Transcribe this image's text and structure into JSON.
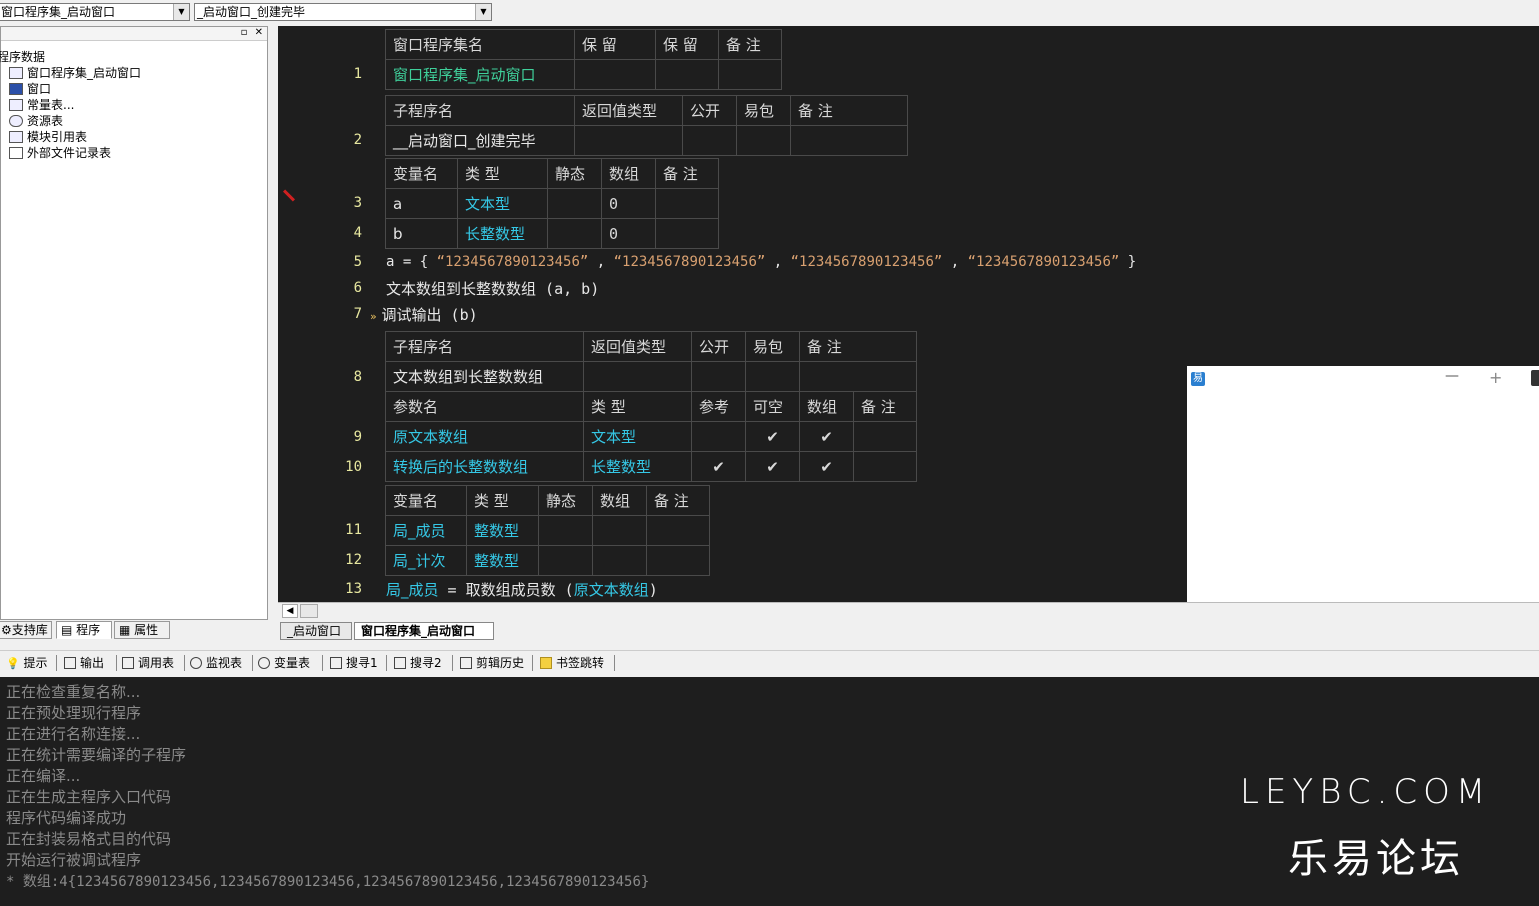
{
  "top": {
    "combo1": "窗口程序集_启动窗口",
    "combo2": "_启动窗口_创建完毕"
  },
  "tree": {
    "root": "程序数据",
    "items": [
      "窗口程序集_启动窗口",
      "窗口",
      "常量表...",
      "资源表",
      "模块引用表",
      "外部文件记录表"
    ]
  },
  "left_tabs": [
    "支持库",
    "程序",
    "属性"
  ],
  "editor": {
    "line_numbers": [
      "1",
      "2",
      "3",
      "4",
      "5",
      "6",
      "7",
      "8",
      "9",
      "10",
      "11",
      "12",
      "13"
    ],
    "t1": {
      "headers": [
        "窗口程序集名",
        "保 留",
        "保 留",
        "备 注"
      ],
      "row": [
        "窗口程序集_启动窗口",
        "",
        "",
        ""
      ]
    },
    "t2": {
      "headers": [
        "子程序名",
        "返回值类型",
        "公开",
        "易包",
        "备 注"
      ],
      "row": [
        "__启动窗口_创建完毕",
        "",
        "",
        "",
        ""
      ]
    },
    "t3": {
      "headers": [
        "变量名",
        "类 型",
        "静态",
        "数组",
        "备 注"
      ],
      "rows": [
        [
          "a",
          "文本型",
          "",
          "0",
          ""
        ],
        [
          "b",
          "长整数型",
          "",
          "0",
          ""
        ]
      ]
    },
    "line5": {
      "lhs": "a = { ",
      "s1": "“1234567890123456”",
      "comma": " , ",
      "s2": "“1234567890123456”",
      "s3": "“1234567890123456”",
      "s4": "“1234567890123456”",
      "close": "  }"
    },
    "line6": {
      "fn": "文本数组到长整数数组",
      "args": " (a, b)"
    },
    "line7": {
      "marker": "»",
      "fn": "调试输出",
      "args": " (b)"
    },
    "t4": {
      "headers": [
        "子程序名",
        "返回值类型",
        "公开",
        "易包",
        "备 注"
      ],
      "row": [
        "文本数组到长整数数组",
        "",
        "",
        "",
        ""
      ],
      "pheaders": [
        "参数名",
        "类 型",
        "参考",
        "可空",
        "数组",
        "备 注"
      ],
      "prows": [
        [
          "原文本数组",
          "文本型",
          "",
          "✔",
          "✔",
          ""
        ],
        [
          "转换后的长整数数组",
          "长整数型",
          "✔",
          "✔",
          "✔",
          ""
        ]
      ]
    },
    "t5": {
      "headers": [
        "变量名",
        "类 型",
        "静态",
        "数组",
        "备 注"
      ],
      "rows": [
        [
          "局_成员",
          "整数型",
          "",
          "",
          ""
        ],
        [
          "局_计次",
          "整数型",
          "",
          "",
          ""
        ]
      ]
    },
    "line13": {
      "lhs": "局_成员",
      "eq": " = ",
      "fn": "取数组成员数",
      "open": " (",
      "arg": "原文本数组",
      "close": ")"
    }
  },
  "file_tabs": [
    "_启动窗口",
    "窗口程序集_启动窗口"
  ],
  "bottom_tabs": [
    "提示",
    "输出",
    "调用表",
    "监视表",
    "变量表",
    "搜寻1",
    "搜寻2",
    "剪辑历史",
    "书签跳转"
  ],
  "output": [
    "正在检查重复名称...",
    "正在预处理现行程序",
    "正在进行名称连接...",
    "正在统计需要编译的子程序",
    "正在编译...",
    "正在生成主程序入口代码",
    "程序代码编译成功",
    "正在封装易格式目的代码",
    "开始运行被调试程序",
    "* 数组:4{1234567890123456,1234567890123456,1234567890123456,1234567890123456}"
  ],
  "watermark": {
    "line1": "LEYBC.COM",
    "line2": "乐易论坛"
  },
  "popup": {
    "minimize": "—",
    "maximize": "+"
  }
}
